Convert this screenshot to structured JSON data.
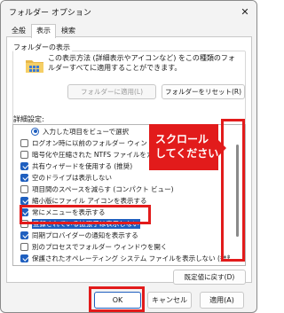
{
  "window": {
    "title": "フォルダー オプション"
  },
  "tabs": [
    {
      "label": "全般",
      "active": false
    },
    {
      "label": "表示",
      "active": true
    },
    {
      "label": "検索",
      "active": false
    }
  ],
  "folder_views": {
    "label": "フォルダーの表示",
    "description": "この表示方法 (詳細表示やアイコンなど) をこの種類のフォルダーすべてに適用することができます。",
    "apply_button": "フォルダーに適用(L)",
    "reset_button": "フォルダーをリセット(R)"
  },
  "advanced": {
    "label": "詳細設定:",
    "items": [
      {
        "type": "radio",
        "checked": true,
        "label": "入力した項目をビューで選択"
      },
      {
        "type": "checkbox",
        "checked": false,
        "label": "ログオン時に以前のフォルダー ウィンドウを表示する"
      },
      {
        "type": "checkbox",
        "checked": false,
        "label": "暗号化や圧縮された NTFS ファイルをカラーで表示する"
      },
      {
        "type": "checkbox",
        "checked": true,
        "label": "共有ウィザードを使用する (推奨)"
      },
      {
        "type": "checkbox",
        "checked": true,
        "label": "空のドライブは表示しない"
      },
      {
        "type": "checkbox",
        "checked": false,
        "label": "項目間のスペースを減らす (コンパクト ビュー)"
      },
      {
        "type": "checkbox",
        "checked": true,
        "label": "縮小版にファイル アイコンを表示する"
      },
      {
        "type": "checkbox",
        "checked": true,
        "label": "常にメニューを表示する"
      },
      {
        "type": "checkbox",
        "checked": false,
        "label": "登録されている拡張子は表示しない",
        "selected": true
      },
      {
        "type": "checkbox",
        "checked": true,
        "label": "同期プロバイダーの通知を表示する"
      },
      {
        "type": "checkbox",
        "checked": false,
        "label": "別のプロセスでフォルダー ウィンドウを開く"
      },
      {
        "type": "checkbox",
        "checked": true,
        "label": "保護されたオペレーティング システム ファイルを表示しない (推奨)"
      }
    ],
    "scroll_fraction": 0.65,
    "restore_button": "既定値に戻す(D)"
  },
  "dialog_buttons": {
    "ok": "OK",
    "cancel": "キャンセル",
    "apply": "適用(A)"
  },
  "annotation": {
    "callout_lines": [
      "スクロール",
      "してください"
    ],
    "color": "#e21b1b"
  },
  "colors": {
    "accent": "#1f5fbf",
    "highlight": "#e21b1b"
  },
  "icons": {
    "close": "close-icon",
    "folder": "folder-icon"
  }
}
